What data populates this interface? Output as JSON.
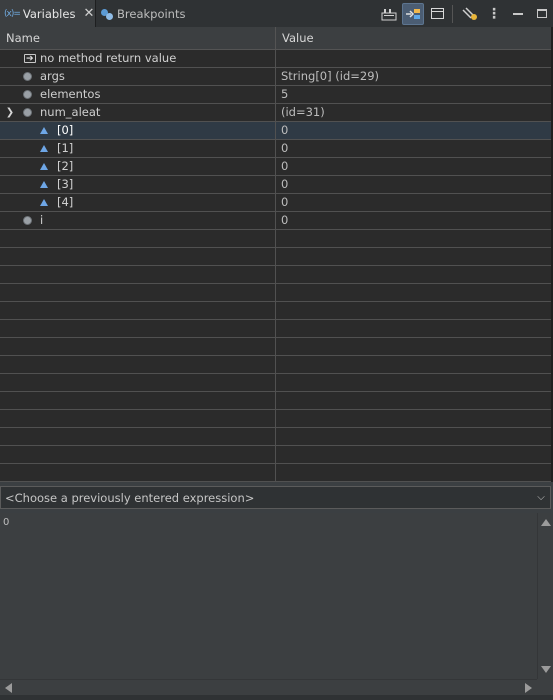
{
  "tabs": [
    {
      "label": "Variables",
      "icon": "variables-icon",
      "active": true
    },
    {
      "label": "Breakpoints",
      "icon": "breakpoints-icon",
      "active": false
    }
  ],
  "toolbar": {
    "icons": [
      "show-type-names-icon",
      "show-logical-structure-icon",
      "collapse-all-icon",
      "view-menu-actions-icon",
      "more-options-icon",
      "minimize-icon",
      "maximize-icon"
    ]
  },
  "table": {
    "columns": {
      "name": "Name",
      "value": "Value"
    },
    "rows": [
      {
        "name": "no method return value",
        "value": "",
        "icon": "method-return-icon"
      },
      {
        "name": "args",
        "value": "String[0]  (id=29)",
        "icon": "local-variable-icon"
      },
      {
        "name": "elementos",
        "value": "5",
        "icon": "local-variable-icon"
      },
      {
        "name": "num_aleat",
        "value": "(id=31)",
        "icon": "local-variable-icon",
        "expanded": true
      },
      {
        "name": "[0]",
        "value": "0",
        "icon": "array-element-icon"
      },
      {
        "name": "[1]",
        "value": "0",
        "icon": "array-element-icon"
      },
      {
        "name": "[2]",
        "value": "0",
        "icon": "array-element-icon"
      },
      {
        "name": "[3]",
        "value": "0",
        "icon": "array-element-icon"
      },
      {
        "name": "[4]",
        "value": "0",
        "icon": "array-element-icon"
      },
      {
        "name": "i",
        "value": "0",
        "icon": "local-variable-icon"
      }
    ]
  },
  "expression": {
    "placeholder": "<Choose a previously entered expression>"
  },
  "detail": {
    "text": "0"
  }
}
